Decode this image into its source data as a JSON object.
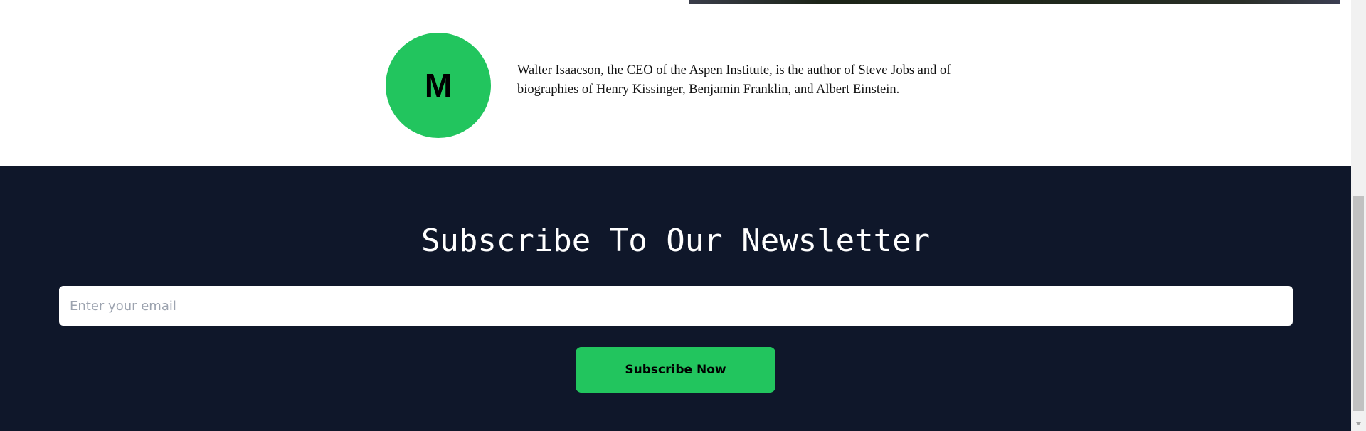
{
  "author": {
    "avatar_initial": "M",
    "bio": "Walter Isaacson, the CEO of the Aspen Institute, is the author of Steve Jobs and of biographies of Henry Kissinger, Benjamin Franklin, and Albert Einstein."
  },
  "newsletter": {
    "title": "Subscribe To Our Newsletter",
    "email_placeholder": "Enter your email",
    "email_value": "",
    "button_label": "Subscribe Now"
  },
  "colors": {
    "accent": "#22c55e",
    "footer_background": "#0f172a"
  },
  "icons": {
    "scroll_down": "chevron-down-icon"
  }
}
